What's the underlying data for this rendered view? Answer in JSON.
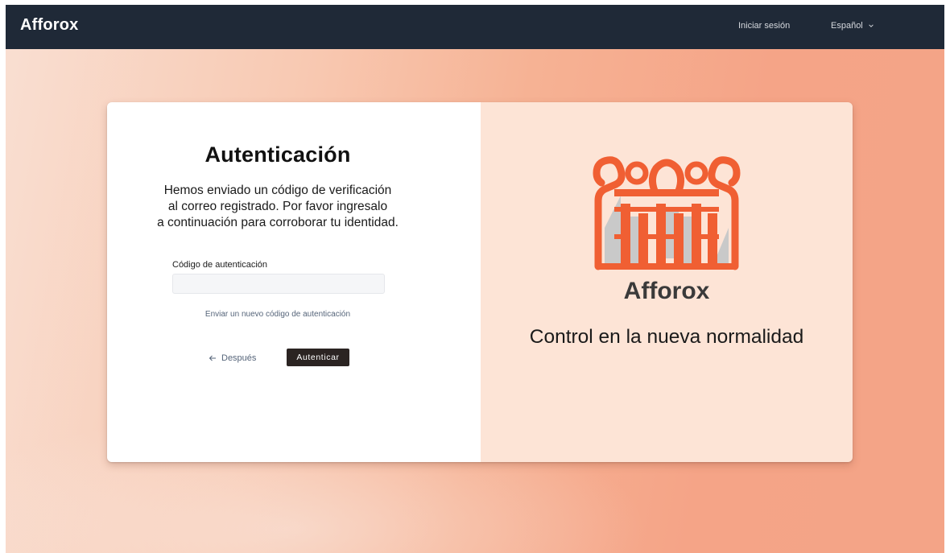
{
  "navbar": {
    "brand": "Afforox",
    "login_link": "Iniciar sesión",
    "language": "Español"
  },
  "auth": {
    "title": "Autenticación",
    "description_lines": [
      "Hemos enviado un código de verificación",
      "al correo registrado. Por favor ingresalo",
      "a continuación para corroborar tu identidad."
    ],
    "code_label": "Código de autenticación",
    "code_value": "",
    "resend_link": "Enviar un nuevo código de autenticación",
    "back_label": "Después",
    "submit_label": "Autenticar"
  },
  "promo": {
    "logo_text": "Afforox",
    "tagline": "Control en la nueva normalidad"
  },
  "colors": {
    "navbar_bg": "#1f2937",
    "logo_orange": "#f05f33",
    "logo_gray": "#c9c9c9",
    "button_dark": "#2b2422",
    "promo_bg": "#fde4d6"
  },
  "icons": {
    "back": "arrow-left-icon",
    "language": "chevron-down-icon"
  }
}
